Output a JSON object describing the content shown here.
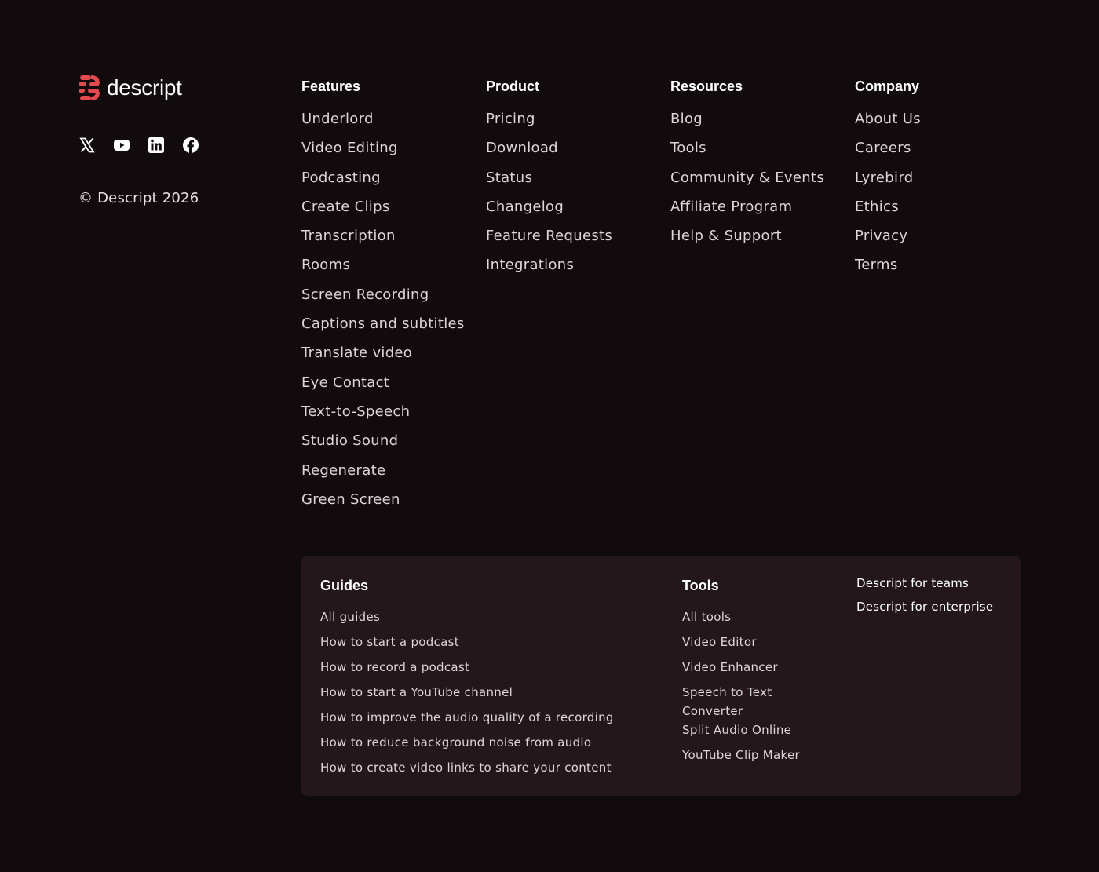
{
  "brand": {
    "name": "descript",
    "accent_color": "#e5484d",
    "copyright": "© Descript 2026"
  },
  "social": [
    {
      "icon": "x-twitter-icon"
    },
    {
      "icon": "youtube-icon"
    },
    {
      "icon": "linkedin-icon"
    },
    {
      "icon": "facebook-icon"
    }
  ],
  "columns": {
    "features": {
      "heading": "Features",
      "items": [
        "Underlord",
        "Video Editing",
        "Podcasting",
        "Create Clips",
        "Transcription",
        "Rooms",
        "Screen Recording",
        "Captions and subtitles",
        "Translate video",
        "Eye Contact",
        "Text-to-Speech",
        "Studio Sound",
        "Regenerate",
        "Green Screen"
      ]
    },
    "product": {
      "heading": "Product",
      "items": [
        "Pricing",
        "Download",
        "Status",
        "Changelog",
        "Feature Requests",
        "Integrations"
      ]
    },
    "resources": {
      "heading": "Resources",
      "items": [
        "Blog",
        "Tools",
        "Community & Events",
        "Affiliate Program",
        "Help & Support"
      ]
    },
    "company": {
      "heading": "Company",
      "items": [
        "About Us",
        "Careers",
        "Lyrebird",
        "Ethics",
        "Privacy",
        "Terms"
      ]
    }
  },
  "panel": {
    "guides": {
      "heading": "Guides",
      "items": [
        "All guides",
        "How to start a podcast",
        "How to record a podcast",
        "How to start a YouTube channel",
        "How to improve the audio quality of a recording",
        "How to reduce background noise from audio",
        "How to create video links to share your content"
      ]
    },
    "tools": {
      "heading": "Tools",
      "items": [
        "All tools",
        "Video Editor",
        "Video Enhancer",
        "Speech to Text Converter",
        "Split Audio Online",
        "YouTube Clip Maker"
      ]
    },
    "links": [
      "Descript for teams",
      "Descript for enterprise"
    ]
  }
}
